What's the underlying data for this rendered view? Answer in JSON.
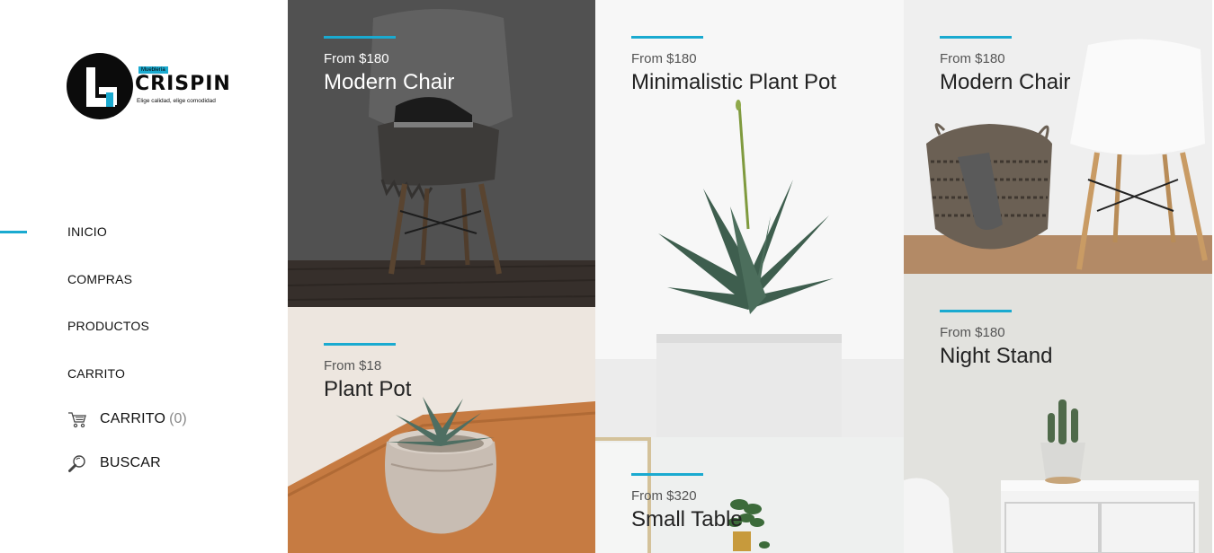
{
  "brand": {
    "tag": "Mueblería",
    "name": "CRISPIN",
    "slogan": "Elige calidad, elige comodidad"
  },
  "nav": {
    "items": [
      {
        "label": "INICIO",
        "active": true
      },
      {
        "label": "COMPRAS"
      },
      {
        "label": "PRODUCTOS"
      },
      {
        "label": "CARRITO"
      }
    ],
    "cart": {
      "label": "CARRITO",
      "count": "(0)",
      "icon": "shopping-cart-icon"
    },
    "search": {
      "label": "BUSCAR",
      "icon": "magnifier-icon"
    }
  },
  "products": [
    {
      "price": "From $180",
      "name": "Modern Chair"
    },
    {
      "price": "From $180",
      "name": "Minimalistic Plant Pot"
    },
    {
      "price": "From $180",
      "name": "Modern Chair"
    },
    {
      "price": "From $18",
      "name": "Plant Pot"
    },
    {
      "price": "From $180",
      "name": "Night Stand"
    },
    {
      "price": "From $320",
      "name": "Small Table"
    }
  ],
  "colors": {
    "accent": "#1aaad0",
    "text": "#222222",
    "muted": "#555555"
  }
}
